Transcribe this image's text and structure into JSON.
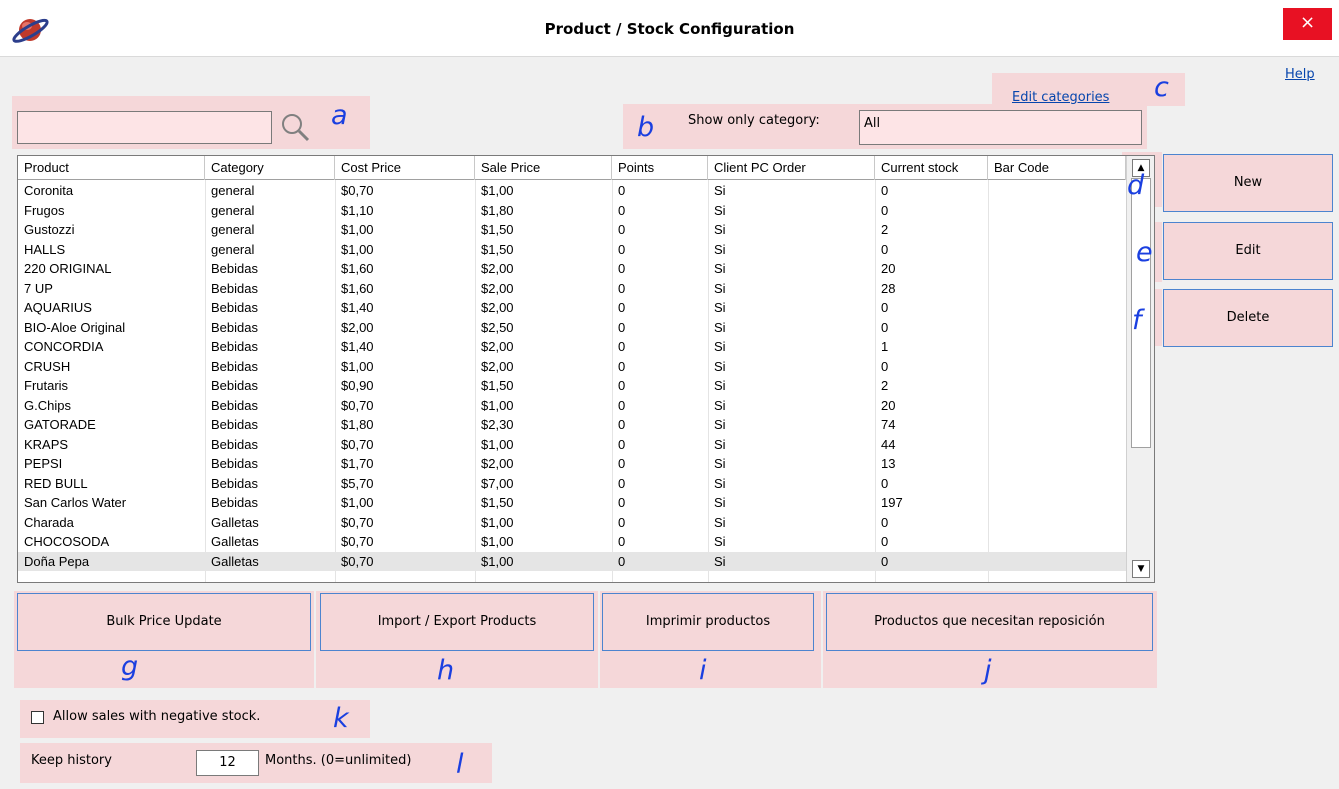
{
  "window": {
    "title": "Product / Stock Configuration",
    "close_label": "×"
  },
  "help_label": "Help",
  "edit_categories_label": "Edit categories",
  "search": {
    "value": "",
    "placeholder": ""
  },
  "category_filter": {
    "label": "Show only category:",
    "value": "All"
  },
  "annotations": {
    "a": "a",
    "b": "b",
    "c": "c",
    "d": "d",
    "e": "e",
    "f": "f",
    "g": "g",
    "h": "h",
    "i": "i",
    "j": "j",
    "k": "k",
    "l": "l"
  },
  "table": {
    "columns": [
      "Product",
      "Category",
      "Cost Price",
      "Sale Price",
      "Points",
      "Client PC Order",
      "Current stock",
      "Bar Code"
    ],
    "rows": [
      [
        "Coronita",
        "general",
        "$0,70",
        "$1,00",
        "0",
        "Si",
        "0",
        ""
      ],
      [
        "Frugos",
        "general",
        "$1,10",
        "$1,80",
        "0",
        "Si",
        "0",
        ""
      ],
      [
        "Gustozzi",
        "general",
        "$1,00",
        "$1,50",
        "0",
        "Si",
        "2",
        ""
      ],
      [
        "HALLS",
        "general",
        "$1,00",
        "$1,50",
        "0",
        "Si",
        "0",
        ""
      ],
      [
        "220 ORIGINAL",
        "Bebidas",
        "$1,60",
        "$2,00",
        "0",
        "Si",
        "20",
        ""
      ],
      [
        "7 UP",
        "Bebidas",
        "$1,60",
        "$2,00",
        "0",
        "Si",
        "28",
        ""
      ],
      [
        "AQUARIUS",
        "Bebidas",
        "$1,40",
        "$2,00",
        "0",
        "Si",
        "0",
        ""
      ],
      [
        "BIO-Aloe Original",
        "Bebidas",
        "$2,00",
        "$2,50",
        "0",
        "Si",
        "0",
        ""
      ],
      [
        "CONCORDIA",
        "Bebidas",
        "$1,40",
        "$2,00",
        "0",
        "Si",
        "1",
        ""
      ],
      [
        "CRUSH",
        "Bebidas",
        "$1,00",
        "$2,00",
        "0",
        "Si",
        "0",
        ""
      ],
      [
        "Frutaris",
        "Bebidas",
        "$0,90",
        "$1,50",
        "0",
        "Si",
        "2",
        ""
      ],
      [
        "G.Chips",
        "Bebidas",
        "$0,70",
        "$1,00",
        "0",
        "Si",
        "20",
        ""
      ],
      [
        "GATORADE",
        "Bebidas",
        "$1,80",
        "$2,30",
        "0",
        "Si",
        "74",
        ""
      ],
      [
        "KRAPS",
        "Bebidas",
        "$0,70",
        "$1,00",
        "0",
        "Si",
        "44",
        ""
      ],
      [
        "PEPSI",
        "Bebidas",
        "$1,70",
        "$2,00",
        "0",
        "Si",
        "13",
        ""
      ],
      [
        "RED  BULL",
        "Bebidas",
        "$5,70",
        "$7,00",
        "0",
        "Si",
        "0",
        ""
      ],
      [
        "San Carlos Water",
        "Bebidas",
        "$1,00",
        "$1,50",
        "0",
        "Si",
        "197",
        ""
      ],
      [
        "Charada",
        "Galletas",
        "$0,70",
        "$1,00",
        "0",
        "Si",
        "0",
        ""
      ],
      [
        "CHOCOSODA",
        "Galletas",
        "$0,70",
        "$1,00",
        "0",
        "Si",
        "0",
        ""
      ],
      [
        "Doña Pepa",
        "Galletas",
        "$0,70",
        "$1,00",
        "0",
        "Si",
        "0",
        ""
      ]
    ]
  },
  "buttons": {
    "new": "New",
    "edit": "Edit",
    "delete": "Delete",
    "bulk_price_update": "Bulk Price Update",
    "import_export": "Import / Export Products",
    "print_products": "Imprimir productos",
    "restock": "Productos que necesitan reposición"
  },
  "negative_stock": {
    "label": "Allow sales with negative stock.",
    "checked": false
  },
  "history": {
    "label": "Keep history",
    "value": "12",
    "unit_label": "Months. (0=unlimited)"
  },
  "colors": {
    "annotation_bg": "#f5d7d9",
    "annotation_letter": "#1a3fe0",
    "button_border": "#4c84cf",
    "close_red": "#e81123"
  }
}
